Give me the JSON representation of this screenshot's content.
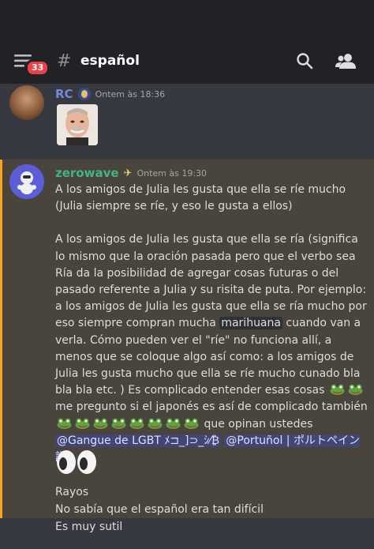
{
  "header": {
    "unread_badge": "33",
    "channel_name": "español",
    "menu_icon": "hamburger-icon",
    "search_icon": "search-icon",
    "members_icon": "members-icon"
  },
  "colors": {
    "background": "#36393f",
    "header": "#202225",
    "highlight": "#49443c",
    "highlight_bar": "#faa61a",
    "mention_bg": "#414675",
    "rc_name": "#7289da",
    "zerowave_name": "#43b581"
  },
  "messages": [
    {
      "author": "RC",
      "timestamp": "Ontem às 18:36",
      "attachment": "harold-sticker"
    },
    {
      "author": "zerowave",
      "timestamp": "Ontem às 19:30",
      "p1": "A los amigos de Julia les gusta que ella se ríe mucho (Julia siempre se ríe, y eso le gusta a ellos)",
      "p2a": "A los amigos de Julia les gusta que ella se ría (significa lo mismo que la oración pasada pero que el verbo sea Ría da la posibilidad de agregar cosas futuras o del pasado referente a Julia y su risita de puta. Por ejemplo: a los amigos de Julia les gusta que ella se ría mucho por eso siempre compran mucha",
      "p2_highlight": "marihuana",
      "p2b": "cuando van a verla. Cómo pueden ver el \"ríe\" no funciona allí, a menos que se coloque algo así como: a los amigos de Julia les gusta mucho que ella se ríe mucho cunado bla bla bla etc. ) Es complicado entender esas cosas",
      "p2c": "me pregunto si el japonés es así de complicado también",
      "p2d": "que opinan ustedes",
      "mention1": "@Gangue de LGBT ﾒ⊐_]⊃_ｼ⁄₿",
      "mention2": "@Portuñol | ポルトペイン語"
    },
    {
      "line1": "Rayos",
      "line2": "No sabía que el español era tan difícil",
      "line3": "Es muy sutil"
    }
  ]
}
